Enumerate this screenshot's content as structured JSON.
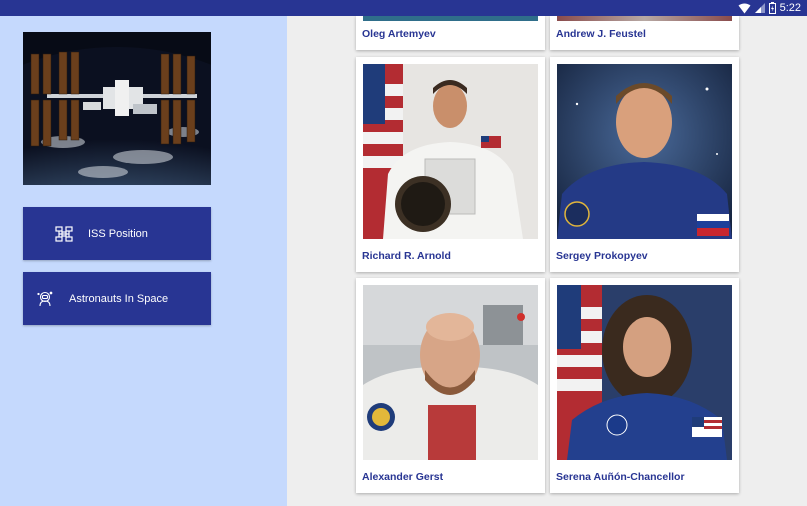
{
  "status_bar": {
    "time": "5:22",
    "background": "#283593"
  },
  "sidebar": {
    "background": "#c5d9fd",
    "image_icon": "iss-photo",
    "buttons": [
      {
        "label": "ISS Position",
        "icon": "satellite-icon"
      },
      {
        "label": "Astronauts In Space",
        "icon": "astronaut-icon"
      }
    ]
  },
  "astronauts": [
    {
      "name": "Oleg Artemyev"
    },
    {
      "name": "Andrew J. Feustel"
    },
    {
      "name": "Richard R. Arnold"
    },
    {
      "name": "Sergey Prokopyev"
    },
    {
      "name": "Alexander Gerst"
    },
    {
      "name": "Serena Auñón-Chancellor"
    }
  ],
  "colors": {
    "accent": "#283593",
    "content_bg": "#eeeeee"
  }
}
